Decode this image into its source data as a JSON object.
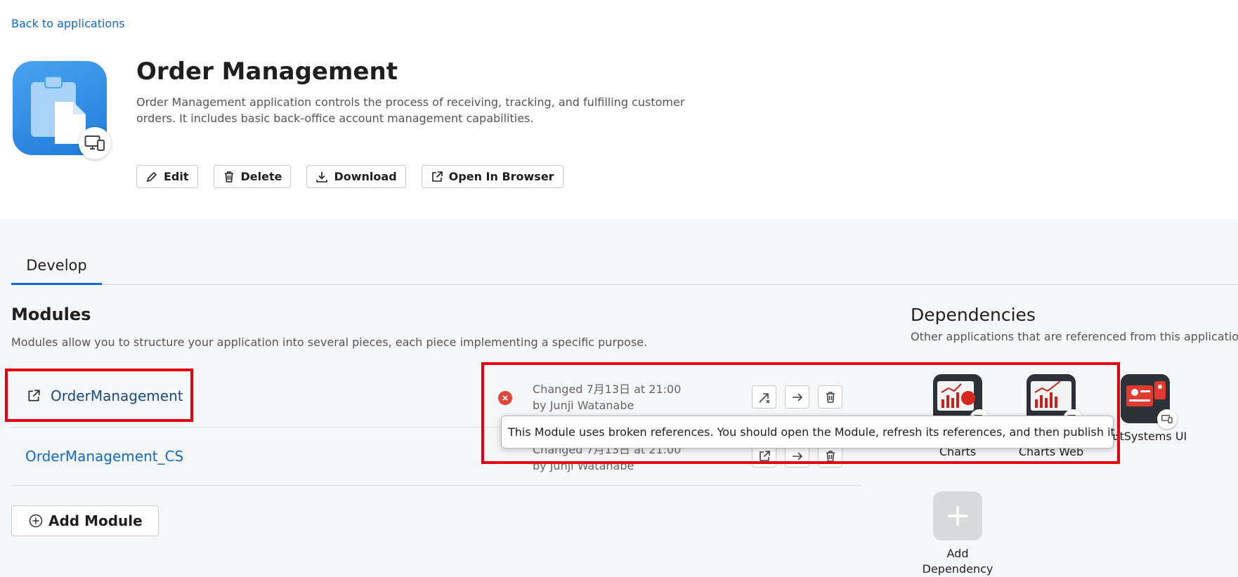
{
  "nav": {
    "back_label": "Back to applications"
  },
  "app": {
    "title": "Order Management",
    "description": "Order Management application controls the process of receiving, tracking, and fulfilling customer orders. It includes basic back-office account management capabilities.",
    "actions": {
      "edit": "Edit",
      "delete": "Delete",
      "download": "Download",
      "open": "Open In Browser"
    }
  },
  "tabs": [
    {
      "label": "Develop",
      "active": true
    }
  ],
  "modules": {
    "title": "Modules",
    "description": "Modules allow you to structure your application into several pieces, each piece implementing a specific purpose.",
    "items": [
      {
        "name": "OrderManagement",
        "changed": "Changed 7月13日 at 21:00",
        "by": "by Junji Watanabe",
        "status": "broken-references"
      },
      {
        "name": "OrderManagement_CS",
        "changed": "Changed 7月13日 at 21:00",
        "by": "by Junji Watanabe"
      }
    ],
    "add_label": "Add Module"
  },
  "tooltip": {
    "text": "This Module uses broken references. You should open the Module, refresh its references, and then publish it."
  },
  "dependencies": {
    "title": "Dependencies",
    "description": "Other applications that are referenced from this application",
    "items": [
      {
        "label": "Charts"
      },
      {
        "label": "Charts Web"
      },
      {
        "label": "OutSystems UI"
      }
    ],
    "add_label_line1": "Add",
    "add_label_line2": "Dependency"
  },
  "colors": {
    "link": "#1068d0",
    "highlight": "#e5000d",
    "error": "#e0453a",
    "app_icon": "#2f8ae4"
  }
}
